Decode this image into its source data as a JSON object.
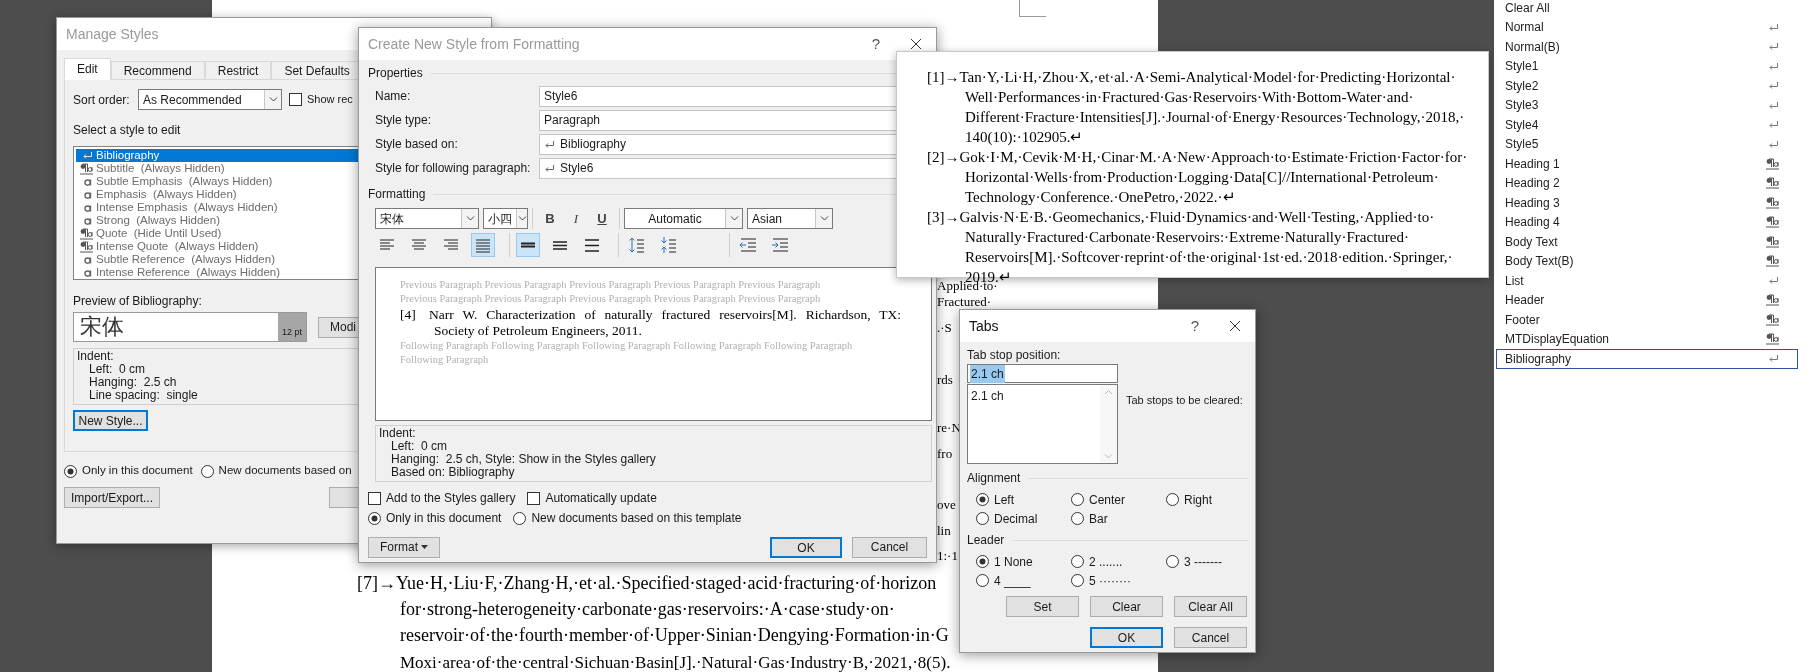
{
  "document": {
    "fragments": [
      "Applied·to·",
      "Fractured·",
      ".·S",
      "rds",
      "re·N",
      "fro",
      "ove",
      "lin",
      "1:·1"
    ],
    "reference": {
      "lines": [
        "[7]→Yue·H,·Liu·F,·Zhang·H,·et·al.·Specified·staged·acid·fracturing·of·horizon",
        "for·strong-heterogeneity·carbonate·gas·reservoirs:·A·case·study·on·",
        "reservoir·of·the·fourth·member·of·Upper·Sinian·Dengying·Formation·in·G",
        "Moxi·area·of·the·central·Sichuan·Basin[J].·Natural·Gas·Industry·B,·2021,·8(5)."
      ]
    }
  },
  "manage_styles": {
    "title": "Manage Styles",
    "tabs": [
      {
        "label": "Edit",
        "selected": true
      },
      {
        "label": "Recommend",
        "selected": false
      },
      {
        "label": "Restrict",
        "selected": false
      },
      {
        "label": "Set Defaults",
        "selected": false
      }
    ],
    "sort_order": {
      "label": "Sort order:",
      "value": "As Recommended"
    },
    "show_recommended": {
      "label": "Show rec",
      "checked": false
    },
    "list_label": "Select a style to edit",
    "styles": [
      {
        "label": "Bibliography",
        "kind": "paragraph",
        "selected": true
      },
      {
        "label": "Subtitle  (Always Hidden)",
        "kind": "linked",
        "selected": false
      },
      {
        "label": "Subtle Emphasis  (Always Hidden)",
        "kind": "character",
        "selected": false
      },
      {
        "label": "Emphasis  (Always Hidden)",
        "kind": "character",
        "selected": false
      },
      {
        "label": "Intense Emphasis  (Always Hidden)",
        "kind": "character",
        "selected": false
      },
      {
        "label": "Strong  (Always Hidden)",
        "kind": "character",
        "selected": false
      },
      {
        "label": "Quote  (Hide Until Used)",
        "kind": "linked",
        "selected": false
      },
      {
        "label": "Intense Quote  (Always Hidden)",
        "kind": "linked",
        "selected": false
      },
      {
        "label": "Subtle Reference  (Always Hidden)",
        "kind": "character",
        "selected": false
      },
      {
        "label": "Intense Reference  (Always Hidden)",
        "kind": "character",
        "selected": false
      }
    ],
    "preview_label": "Preview of Bibliography:",
    "preview": {
      "sample": "宋体",
      "size": "12 pt"
    },
    "modify_button": "Modi",
    "description": [
      "Indent:",
      "Left:  0 cm",
      "Hanging:  2.5 ch",
      "Line spacing:  single"
    ],
    "new_style_button": "New Style...",
    "scope": [
      {
        "label": "Only in this document",
        "selected": true
      },
      {
        "label": "New documents based on",
        "selected": false
      }
    ],
    "import_export_button": "Import/Export..."
  },
  "create_style": {
    "title": "Create New Style from Formatting",
    "help": "?",
    "properties_label": "Properties",
    "fields": [
      {
        "label": "Name:",
        "value": "Style6",
        "kind": "text"
      },
      {
        "label": "Style type:",
        "value": "Paragraph",
        "kind": "text"
      },
      {
        "label": "Style based on:",
        "value": "Bibliography",
        "kind": "style"
      },
      {
        "label": "Style for following paragraph:",
        "value": "Style6",
        "kind": "style"
      }
    ],
    "formatting_label": "Formatting",
    "font": "宋体",
    "size": "小四",
    "bold": "B",
    "italic": "I",
    "underline": "U",
    "font_color": "Automatic",
    "script": "Asian",
    "paragraph_tools": [
      [
        {
          "kind": "align_left",
          "selected": false
        },
        {
          "kind": "align_center",
          "selected": false
        },
        {
          "kind": "align_right",
          "selected": false
        },
        {
          "kind": "justify",
          "selected": true
        }
      ],
      [
        {
          "kind": "single",
          "selected": true
        },
        {
          "kind": "one_half",
          "selected": false
        },
        {
          "kind": "double",
          "selected": false
        }
      ],
      [
        {
          "kind": "space_increase"
        },
        {
          "kind": "space_decrease"
        }
      ],
      [
        {
          "kind": "indent_decrease"
        },
        {
          "kind": "indent_increase"
        }
      ]
    ],
    "preview": {
      "previous": [
        "Previous Paragraph Previous Paragraph Previous Paragraph Previous Paragraph Previous Paragraph",
        "Previous Paragraph Previous Paragraph Previous Paragraph Previous Paragraph Previous Paragraph"
      ],
      "sample_label": "[4]",
      "sample_lines": [
        "Narr W. Characterization of naturally fractured reservoirs[M]. Richardson, TX:",
        "Society of Petroleum Engineers, 2011."
      ],
      "following": [
        "Following Paragraph Following Paragraph Following Paragraph Following Paragraph Following Paragraph",
        "Following Paragraph"
      ]
    },
    "description": [
      "Indent:",
      "Left:  0 cm",
      "Hanging:  2.5 ch, Style: Show in the Styles gallery",
      "Based on: Bibliography"
    ],
    "options": [
      {
        "label": "Add to the Styles gallery",
        "checked": false
      },
      {
        "label": "Automatically update",
        "checked": false
      }
    ],
    "scope": [
      {
        "label": "Only in this document",
        "selected": true
      },
      {
        "label": "New documents based on this template",
        "selected": false
      }
    ],
    "format_button": "Format",
    "ok_button": "OK",
    "cancel_button": "Cancel"
  },
  "reference_popup": {
    "references": [
      {
        "lines": [
          "[1]→Tan·Y,·Li·H,·Zhou·X,·et·al.·A·Semi-Analytical·Model·for·Predicting·Horizontal·",
          "Well·Performances·in·Fractured·Gas·Reservoirs·With·Bottom-Water·and·",
          "Different·Fracture·Intensities[J].·Journal·of·Energy·Resources·Technology,·2018,·",
          "140(10):·102905.↵"
        ]
      },
      {
        "lines": [
          "[2]→Gok·I·M,·Cevik·M·H,·Cinar·M.·A·New·Approach·to·Estimate·Friction·Factor·for·",
          "Horizontal·Wells·from·Production·Logging·Data[C]//International·Petroleum·",
          "Technology·Conference.·OnePetro,·2022.·↵"
        ]
      },
      {
        "lines": [
          "[3]→Galvis·N·E·B.·Geomechanics,·Fluid·Dynamics·and·Well·Testing,·Applied·to·",
          "Naturally·Fractured·Carbonate·Reservoirs:·Extreme·Naturally·Fractured·",
          "Reservoirs[M].·Softcover·reprint·of·the·original·1st·ed.·2018·edition.·Springer,·",
          "2019.↵"
        ]
      }
    ]
  },
  "tabs_dialog": {
    "title": "Tabs",
    "help": "?",
    "position_label": "Tab stop position:",
    "position_value": "2.1 ch",
    "position_selected": true,
    "stops": [
      "2.1 ch"
    ],
    "clear_label": "Tab stops to be cleared:",
    "alignment_label": "Alignment",
    "alignment": [
      {
        "label": "Left",
        "selected": true
      },
      {
        "label": "Center",
        "selected": false
      },
      {
        "label": "Right",
        "selected": false
      },
      {
        "label": "Decimal",
        "selected": false
      },
      {
        "label": "Bar",
        "selected": false
      }
    ],
    "leader_label": "Leader",
    "leaders": [
      {
        "label": "1 None",
        "selected": true
      },
      {
        "label": "2 .......",
        "selected": false
      },
      {
        "label": "3 -------",
        "selected": false
      },
      {
        "label": "4 ____",
        "selected": false
      },
      {
        "label": "5 ········",
        "selected": false
      }
    ],
    "buttons": [
      "Set",
      "Clear",
      "Clear All"
    ],
    "ok_button": "OK",
    "cancel_button": "Cancel"
  },
  "styles_pane": {
    "items": [
      {
        "label": "Clear All",
        "kind": "command",
        "selected": false
      },
      {
        "label": "Normal",
        "kind": "paragraph",
        "selected": false
      },
      {
        "label": "Normal(B)",
        "kind": "paragraph",
        "selected": false
      },
      {
        "label": "Style1",
        "kind": "paragraph",
        "selected": false
      },
      {
        "label": "Style2",
        "kind": "paragraph",
        "selected": false
      },
      {
        "label": "Style3",
        "kind": "paragraph",
        "selected": false
      },
      {
        "label": "Style4",
        "kind": "paragraph",
        "selected": false
      },
      {
        "label": "Style5",
        "kind": "paragraph",
        "selected": false
      },
      {
        "label": "Heading 1",
        "kind": "linked",
        "selected": false
      },
      {
        "label": "Heading 2",
        "kind": "linked",
        "selected": false
      },
      {
        "label": "Heading 3",
        "kind": "linked",
        "selected": false
      },
      {
        "label": "Heading 4",
        "kind": "linked",
        "selected": false
      },
      {
        "label": "Body Text",
        "kind": "linked",
        "selected": false
      },
      {
        "label": "Body Text(B)",
        "kind": "linked",
        "selected": false
      },
      {
        "label": "List",
        "kind": "paragraph",
        "selected": false
      },
      {
        "label": "Header",
        "kind": "linked",
        "selected": false
      },
      {
        "label": "Footer",
        "kind": "linked",
        "selected": false
      },
      {
        "label": "MTDisplayEquation",
        "kind": "linked",
        "selected": false
      },
      {
        "label": "Bibliography",
        "kind": "paragraph",
        "selected": true
      }
    ]
  }
}
